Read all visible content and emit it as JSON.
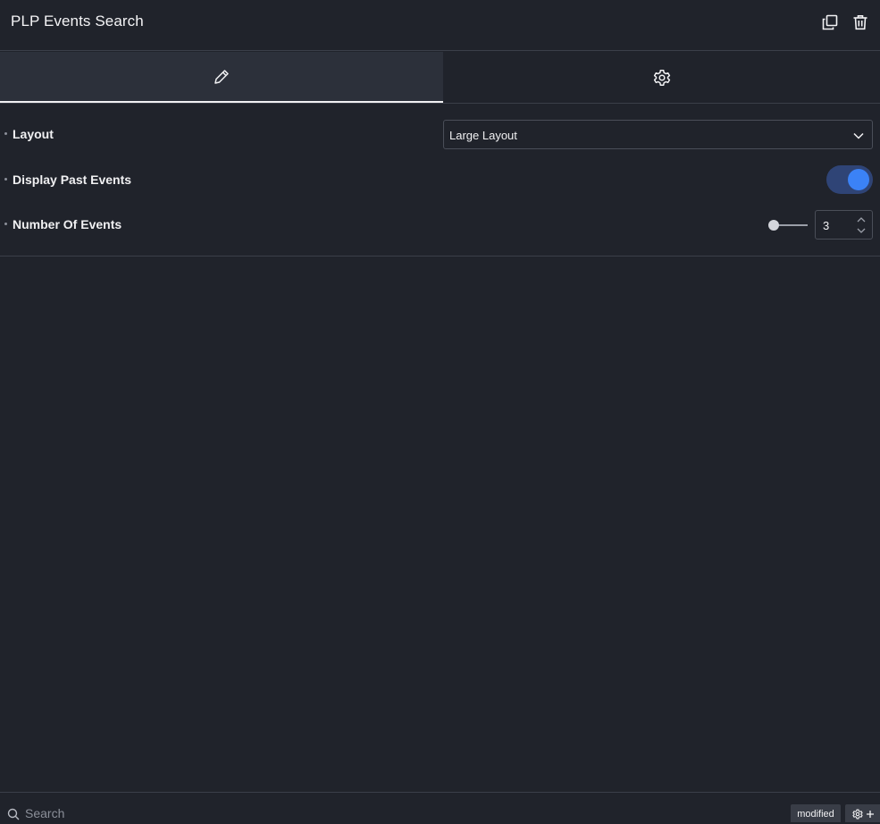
{
  "header": {
    "title": "PLP Events Search",
    "actions": [
      {
        "name": "duplicate",
        "icon": "duplicate-icon"
      },
      {
        "name": "delete",
        "icon": "trash-icon"
      }
    ]
  },
  "tabs": [
    {
      "name": "content",
      "icon": "pencil-icon",
      "active": true
    },
    {
      "name": "advanced",
      "icon": "gear-icon",
      "active": false
    }
  ],
  "controls": {
    "layout": {
      "label": "Layout",
      "selected": "Large Layout"
    },
    "display_past_events": {
      "label": "Display Past Events",
      "enabled": true
    },
    "number_of_events": {
      "label": "Number Of Events",
      "value": "3",
      "slider_fraction": 0.0
    }
  },
  "footer": {
    "search_placeholder": "Search",
    "modified_label": "modified"
  },
  "colors": {
    "background": "#20232b",
    "active_tab": "#2c303a",
    "accent": "#3b82f6",
    "toggle_track": "#2f4476",
    "border": "#3b3f49"
  }
}
